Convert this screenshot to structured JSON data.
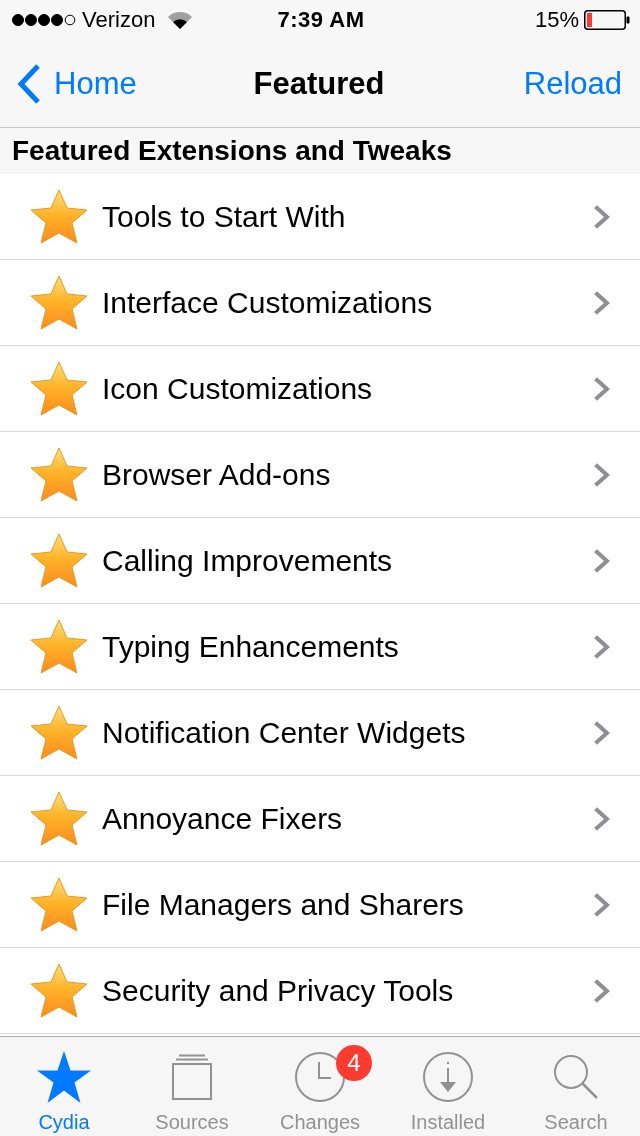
{
  "status_bar": {
    "carrier": "Verizon",
    "time": "7:39 AM",
    "battery": "15%"
  },
  "nav": {
    "back": "Home",
    "title": "Featured",
    "action": "Reload"
  },
  "section": {
    "title": "Featured Extensions and Tweaks",
    "items": [
      {
        "label": "Tools to Start With"
      },
      {
        "label": "Interface Customizations"
      },
      {
        "label": "Icon Customizations"
      },
      {
        "label": "Browser Add-ons"
      },
      {
        "label": "Calling Improvements"
      },
      {
        "label": "Typing Enhancements"
      },
      {
        "label": "Notification Center Widgets"
      },
      {
        "label": "Annoyance Fixers"
      },
      {
        "label": "File Managers and Sharers"
      },
      {
        "label": "Security and Privacy Tools"
      }
    ]
  },
  "tab_bar": [
    {
      "label": "Cydia",
      "selected": true
    },
    {
      "label": "Sources",
      "selected": false
    },
    {
      "label": "Changes",
      "selected": false,
      "badge": "4"
    },
    {
      "label": "Installed",
      "selected": false
    },
    {
      "label": "Search",
      "selected": false
    }
  ]
}
